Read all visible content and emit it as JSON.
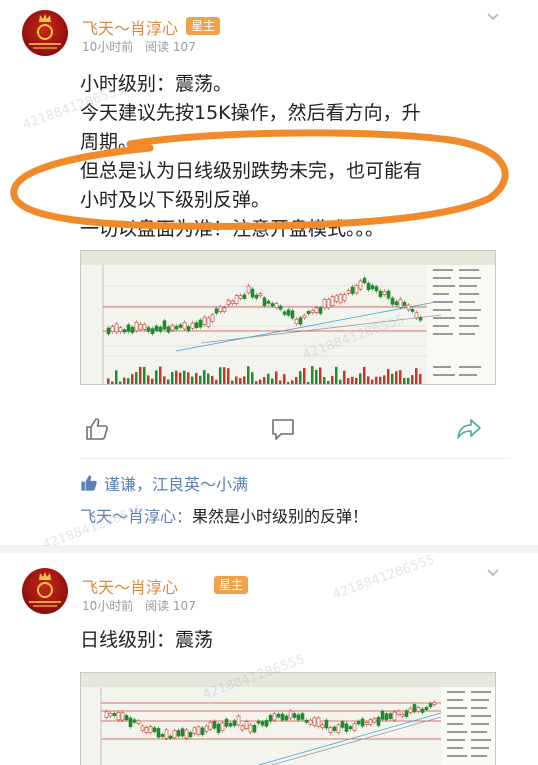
{
  "posts": [
    {
      "username": "飞天～肖淳心",
      "badge": "星主",
      "time": "10小时前",
      "reads": "阅读 107",
      "lines": [
        "小时级别：震荡。",
        "今天建议先按15K操作，然后看方向，升",
        "周期。",
        "但总是认为日线级别跌势未完，也可能有",
        "小时及以下级别反弹。",
        "一切以盘面为准！注意开盘模式。。。"
      ],
      "likes": "谨谦，江良英～小满",
      "comment_user": "飞天～肖淳心：",
      "comment_text": "果然是小时级别的反弹！"
    },
    {
      "username": "飞天～肖淳心",
      "badge": "星主",
      "time": "10小时前",
      "reads": "阅读 107",
      "lines": [
        "日线级别：震荡"
      ]
    }
  ],
  "icons": {
    "like": "thumbs-up-icon",
    "comment": "comment-icon",
    "share": "share-icon",
    "more": "chevron-down-icon",
    "liked": "thumbs-up-filled-icon"
  },
  "colors": {
    "username": "#d88a3a",
    "badge": "#f0a24a",
    "link": "#5b7fb3",
    "annotation": "#f08a2a",
    "candle_up": "#c0392b",
    "candle_down": "#1e8c2e"
  },
  "watermark": "4218841286555"
}
